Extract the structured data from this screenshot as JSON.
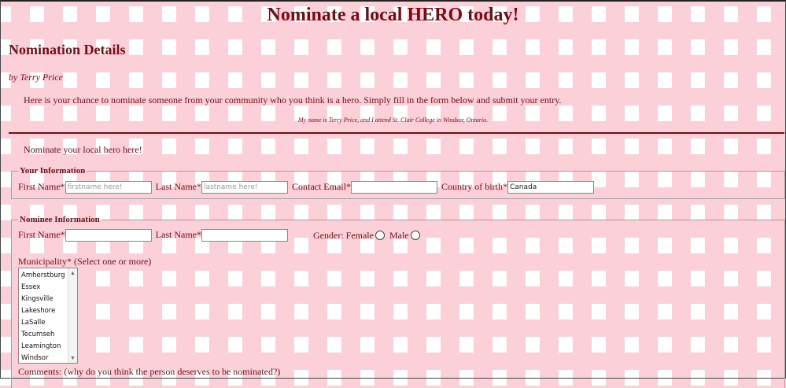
{
  "page": {
    "title": "Nominate a local HERO today!",
    "section_title": "Nomination Details",
    "byline": "by Terry Price",
    "intro": "Here is your chance to nominate someone from your community who you think is a hero. Simply fill in the form below and submit your entry.",
    "note": "My name is Terry Price, and I attend St. Clair College in Windsor, Ontario.",
    "lead": "Nominate your local hero here!"
  },
  "your_info": {
    "legend": "Your Information",
    "first_name_label": "First Name*",
    "first_name_placeholder": "firstname here!",
    "last_name_label": "Last Name*",
    "last_name_placeholder": "lastname here!",
    "email_label": "Contact Email*",
    "email_value": "",
    "country_label": "Country of birth*",
    "country_value": "Canada"
  },
  "nominee_info": {
    "legend": "Nominee Information",
    "first_name_label": "First Name*",
    "last_name_label": "Last Name*",
    "gender_label": "Gender: Female",
    "male_label": "Male",
    "municipality_label": "Municipality* (Select one or more)",
    "municipalities": [
      "Amherstburg",
      "Essex",
      "Kingsville",
      "Lakeshore",
      "LaSalle",
      "Tecumseh",
      "Leamington",
      "Windsor"
    ],
    "comments_label": "Comments: (why do you think the person deserves to be nominated?)"
  },
  "colors": {
    "text": "#7a0a14",
    "pattern": "#fcd0d8"
  }
}
